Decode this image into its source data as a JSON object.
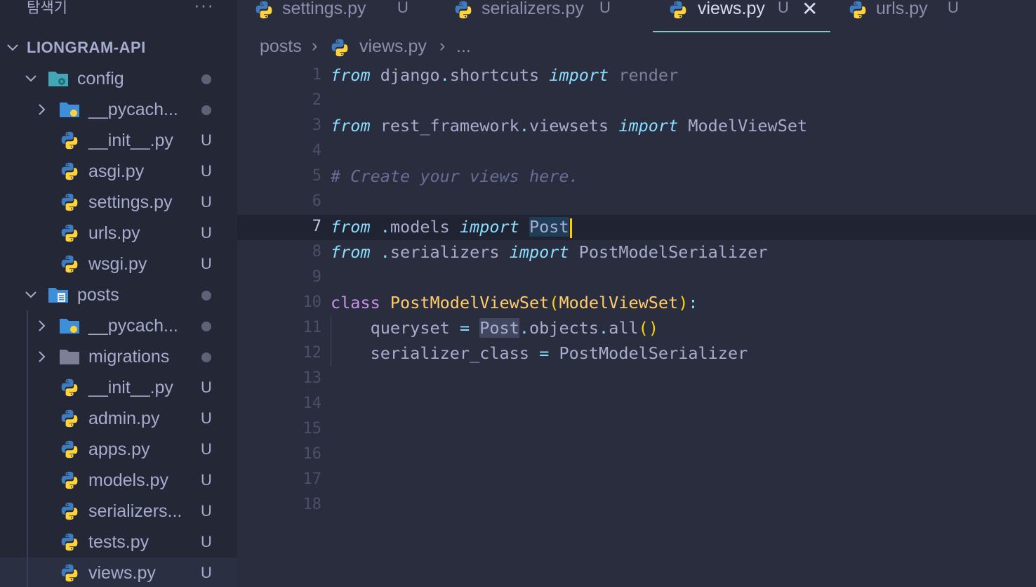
{
  "explorer": {
    "title": "탐색기",
    "more": "···",
    "root": "LIONGRAM-API",
    "items": [
      {
        "label": "config",
        "status": ""
      },
      {
        "label": "__pycach...",
        "status": ""
      },
      {
        "label": "__init__.py",
        "status": "U"
      },
      {
        "label": "asgi.py",
        "status": "U"
      },
      {
        "label": "settings.py",
        "status": "U"
      },
      {
        "label": "urls.py",
        "status": "U"
      },
      {
        "label": "wsgi.py",
        "status": "U"
      },
      {
        "label": "posts",
        "status": ""
      },
      {
        "label": "__pycach...",
        "status": ""
      },
      {
        "label": "migrations",
        "status": ""
      },
      {
        "label": "__init__.py",
        "status": "U"
      },
      {
        "label": "admin.py",
        "status": "U"
      },
      {
        "label": "apps.py",
        "status": "U"
      },
      {
        "label": "models.py",
        "status": "U"
      },
      {
        "label": "serializers...",
        "status": "U"
      },
      {
        "label": "tests.py",
        "status": "U"
      },
      {
        "label": "views.py",
        "status": "U"
      }
    ]
  },
  "tabs": [
    {
      "label": "settings.py",
      "status": "U"
    },
    {
      "label": "serializers.py",
      "status": "U"
    },
    {
      "label": "views.py",
      "status": "U"
    },
    {
      "label": "urls.py",
      "status": "U"
    }
  ],
  "tab_close": "✕",
  "breadcrumb": {
    "folder": "posts",
    "file": "views.py",
    "more": "..."
  },
  "editor": {
    "line_numbers": [
      "1",
      "2",
      "3",
      "4",
      "5",
      "6",
      "7",
      "8",
      "9",
      "10",
      "11",
      "12",
      "13",
      "14",
      "15",
      "16",
      "17",
      "18"
    ],
    "t": {
      "from": "from",
      "import": "import",
      "class": "class",
      "dot": ".",
      "eq": "=",
      "colon": ":",
      "lparen": "(",
      "rparen": ")",
      "l1_django": "django",
      "l1_shortcuts": "shortcuts",
      "l1_render": "render",
      "l3_rest": "rest_framework",
      "l3_viewsets": "viewsets",
      "l3_mvs": "ModelViewSet",
      "l5_comment": "# Create your views here.",
      "l7_models": "models",
      "l7_post": "Post",
      "l8_serializers": "serializers",
      "l8_pms": "PostModelSerializer",
      "l10_name": "PostModelViewSet",
      "l10_base": "ModelViewSet",
      "l11_queryset": "queryset",
      "l11_post": "Post",
      "l11_objects": "objects",
      "l11_all": "all",
      "l12_attr": "serializer_class",
      "l12_pms": "PostModelSerializer"
    }
  }
}
